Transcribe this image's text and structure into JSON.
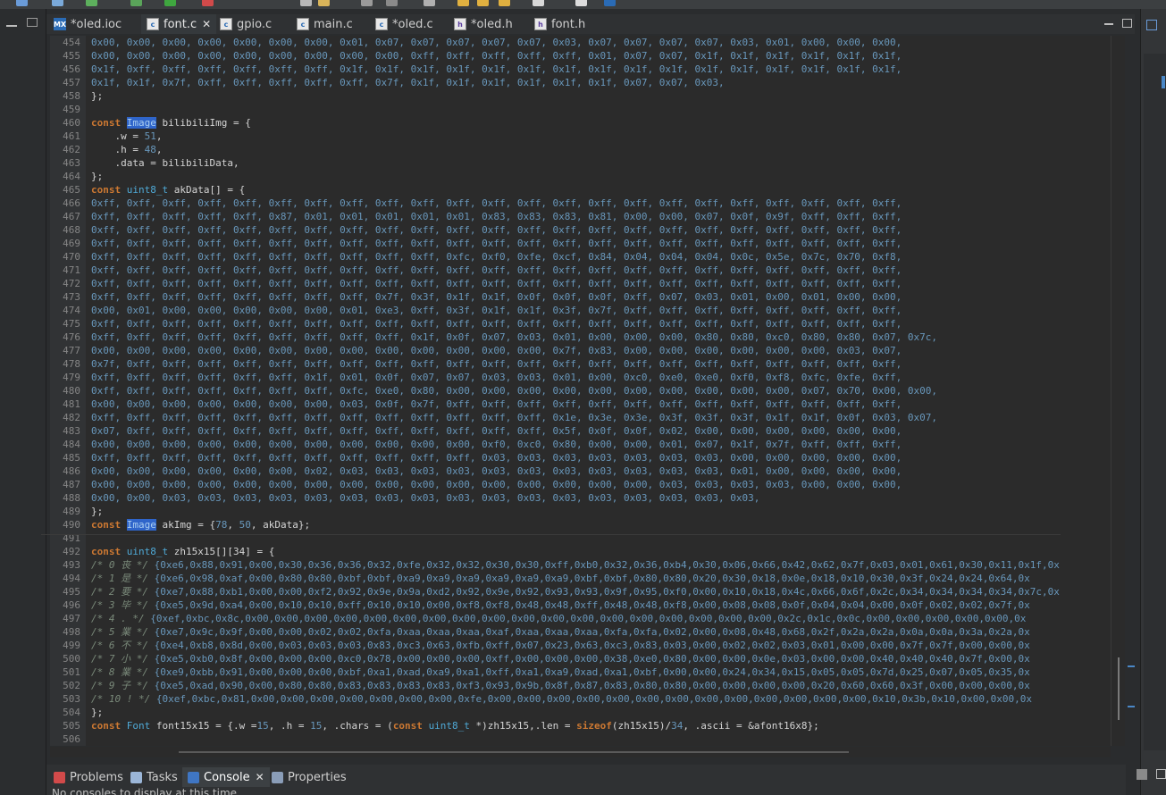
{
  "tabs": [
    {
      "label": "*oled.ioc",
      "icon": "mx-icon"
    },
    {
      "label": "font.c",
      "icon": "c-file-icon",
      "active": true,
      "close": "✕"
    },
    {
      "label": "gpio.c",
      "icon": "c-file-icon"
    },
    {
      "label": "main.c",
      "icon": "c-file-icon"
    },
    {
      "label": "*oled.c",
      "icon": "c-file-icon"
    },
    {
      "label": "*oled.h",
      "icon": "h-file-icon"
    },
    {
      "label": "font.h",
      "icon": "h-file-icon"
    }
  ],
  "tab_icon_text": {
    "mx": "MX",
    "c": "c",
    "h": "h"
  },
  "line_numbers": [
    "454",
    "455",
    "456",
    "457",
    "458",
    "459",
    "460",
    "461",
    "462",
    "463",
    "464",
    "465",
    "466",
    "467",
    "468",
    "469",
    "470",
    "471",
    "472",
    "473",
    "474",
    "475",
    "476",
    "477",
    "478",
    "479",
    "480",
    "481",
    "482",
    "483",
    "484",
    "485",
    "486",
    "487",
    "488",
    "489",
    "490",
    "491",
    "492",
    "493",
    "494",
    "495",
    "496",
    "497",
    "498",
    "499",
    "500",
    "501",
    "502",
    "503",
    "504",
    "505",
    "506"
  ],
  "code": {
    "l454": "0x00, 0x00, 0x00, 0x00, 0x00, 0x00, 0x00, 0x01, 0x07, 0x07, 0x07, 0x07, 0x07, 0x03, 0x07, 0x07, 0x07, 0x07, 0x03, 0x01, 0x00, 0x00, 0x00,",
    "l455": "0x00, 0x00, 0x00, 0x00, 0x00, 0x00, 0x00, 0x00, 0x00, 0xff, 0xff, 0xff, 0xff, 0xff, 0x01, 0x07, 0x07, 0x1f, 0x1f, 0x1f, 0x1f, 0x1f, 0x1f,",
    "l456": "0x1f, 0xff, 0xff, 0xff, 0xff, 0xff, 0xff, 0x1f, 0x1f, 0x1f, 0x1f, 0x1f, 0x1f, 0x1f, 0x1f, 0x1f, 0x1f, 0x1f, 0x1f, 0x1f, 0x1f, 0x1f, 0x1f,",
    "l457": "0x1f, 0x1f, 0x7f, 0xff, 0xff, 0xff, 0xff, 0xff, 0x7f, 0x1f, 0x1f, 0x1f, 0x1f, 0x1f, 0x1f, 0x07, 0x07, 0x03,",
    "l458": "};",
    "l460_kw": "const",
    "l460_ty": "Image",
    "l460_rest": " bilibiliImg = {",
    "l461_a": "    .w = ",
    "l461_n": "51",
    "l461_b": ",",
    "l462_a": "    .h = ",
    "l462_n": "48",
    "l462_b": ",",
    "l463": "    .data = bilibiliData,",
    "l464": "};",
    "l465_kw": "const",
    "l465_ty": "uint8_t",
    "l465_rest": " akData[] = {",
    "l466": "0xff, 0xff, 0xff, 0xff, 0xff, 0xff, 0xff, 0xff, 0xff, 0xff, 0xff, 0xff, 0xff, 0xff, 0xff, 0xff, 0xff, 0xff, 0xff, 0xff, 0xff, 0xff, 0xff,",
    "l467": "0xff, 0xff, 0xff, 0xff, 0xff, 0x87, 0x01, 0x01, 0x01, 0x01, 0x01, 0x83, 0x83, 0x83, 0x81, 0x00, 0x00, 0x07, 0x0f, 0x9f, 0xff, 0xff, 0xff,",
    "l468": "0xff, 0xff, 0xff, 0xff, 0xff, 0xff, 0xff, 0xff, 0xff, 0xff, 0xff, 0xff, 0xff, 0xff, 0xff, 0xff, 0xff, 0xff, 0xff, 0xff, 0xff, 0xff, 0xff,",
    "l469": "0xff, 0xff, 0xff, 0xff, 0xff, 0xff, 0xff, 0xff, 0xff, 0xff, 0xff, 0xff, 0xff, 0xff, 0xff, 0xff, 0xff, 0xff, 0xff, 0xff, 0xff, 0xff, 0xff,",
    "l470": "0xff, 0xff, 0xff, 0xff, 0xff, 0xff, 0xff, 0xff, 0xff, 0xff, 0xfc, 0xf0, 0xfe, 0xcf, 0x84, 0x04, 0x04, 0x04, 0x0c, 0x5e, 0x7c, 0x70, 0xf8,",
    "l471": "0xff, 0xff, 0xff, 0xff, 0xff, 0xff, 0xff, 0xff, 0xff, 0xff, 0xff, 0xff, 0xff, 0xff, 0xff, 0xff, 0xff, 0xff, 0xff, 0xff, 0xff, 0xff, 0xff,",
    "l472": "0xff, 0xff, 0xff, 0xff, 0xff, 0xff, 0xff, 0xff, 0xff, 0xff, 0xff, 0xff, 0xff, 0xff, 0xff, 0xff, 0xff, 0xff, 0xff, 0xff, 0xff, 0xff, 0xff,",
    "l473": "0xff, 0xff, 0xff, 0xff, 0xff, 0xff, 0xff, 0xff, 0x7f, 0x3f, 0x1f, 0x1f, 0x0f, 0x0f, 0x0f, 0xff, 0x07, 0x03, 0x01, 0x00, 0x01, 0x00, 0x00,",
    "l474": "0x00, 0x01, 0x00, 0x00, 0x00, 0x00, 0x00, 0x01, 0xe3, 0xff, 0x3f, 0x1f, 0x1f, 0x3f, 0x7f, 0xff, 0xff, 0xff, 0xff, 0xff, 0xff, 0xff, 0xff,",
    "l475": "0xff, 0xff, 0xff, 0xff, 0xff, 0xff, 0xff, 0xff, 0xff, 0xff, 0xff, 0xff, 0xff, 0xff, 0xff, 0xff, 0xff, 0xff, 0xff, 0xff, 0xff, 0xff, 0xff,",
    "l476": "0xff, 0xff, 0xff, 0xff, 0xff, 0xff, 0xff, 0xff, 0xff, 0x1f, 0x0f, 0x07, 0x03, 0x01, 0x00, 0x00, 0x00, 0x80, 0x80, 0xc0, 0x80, 0x80, 0x07, 0x7c,",
    "l477": "0x00, 0x00, 0x00, 0x00, 0x00, 0x00, 0x00, 0x00, 0x00, 0x00, 0x00, 0x00, 0x00, 0x7f, 0x83, 0x00, 0x00, 0x00, 0x00, 0x00, 0x00, 0x03, 0x07,",
    "l478": "0x7f, 0xff, 0xff, 0xff, 0xff, 0xff, 0xff, 0xff, 0xff, 0xff, 0xff, 0xff, 0xff, 0xff, 0xff, 0xff, 0xff, 0xff, 0xff, 0xff, 0xff, 0xff, 0xff,",
    "l479": "0xff, 0xff, 0xff, 0xff, 0xff, 0xff, 0x1f, 0x01, 0x0f, 0x07, 0x07, 0x03, 0x03, 0x01, 0x00, 0xc0, 0xe0, 0xe0, 0xf0, 0xf8, 0xfc, 0xfe, 0xff,",
    "l480": "0xff, 0xff, 0xff, 0xff, 0xff, 0xff, 0xff, 0xfc, 0xe0, 0x80, 0x00, 0x00, 0x00, 0x00, 0x00, 0x00, 0x00, 0x00, 0x00, 0x00, 0x07, 0x70, 0x00, 0x00,",
    "l481": "0x00, 0x00, 0x00, 0x00, 0x00, 0x00, 0x00, 0x03, 0x0f, 0x7f, 0xff, 0xff, 0xff, 0xff, 0xff, 0xff, 0xff, 0xff, 0xff, 0xff, 0xff, 0xff, 0xff,",
    "l482": "0xff, 0xff, 0xff, 0xff, 0xff, 0xff, 0xff, 0xff, 0xff, 0xff, 0xff, 0xff, 0xff, 0x1e, 0x3e, 0x3e, 0x3f, 0x3f, 0x3f, 0x1f, 0x1f, 0x0f, 0x03, 0x07,",
    "l483": "0x07, 0xff, 0xff, 0xff, 0xff, 0xff, 0xff, 0xff, 0xff, 0xff, 0xff, 0xff, 0xff, 0x5f, 0x0f, 0x0f, 0x02, 0x00, 0x00, 0x00, 0x00, 0x00, 0x00,",
    "l484": "0x00, 0x00, 0x00, 0x00, 0x00, 0x00, 0x00, 0x00, 0x00, 0x00, 0x00, 0xf0, 0xc0, 0x80, 0x00, 0x00, 0x01, 0x07, 0x1f, 0x7f, 0xff, 0xff, 0xff,",
    "l485": "0xff, 0xff, 0xff, 0xff, 0xff, 0xff, 0xff, 0xff, 0xff, 0xff, 0xff, 0x03, 0x03, 0x03, 0x03, 0x03, 0x03, 0x03, 0x00, 0x00, 0x00, 0x00, 0x00,",
    "l486": "0x00, 0x00, 0x00, 0x00, 0x00, 0x00, 0x02, 0x03, 0x03, 0x03, 0x03, 0x03, 0x03, 0x03, 0x03, 0x03, 0x03, 0x03, 0x01, 0x00, 0x00, 0x00, 0x00,",
    "l487": "0x00, 0x00, 0x00, 0x00, 0x00, 0x00, 0x00, 0x00, 0x00, 0x00, 0x00, 0x00, 0x00, 0x00, 0x00, 0x00, 0x03, 0x03, 0x03, 0x03, 0x00, 0x00, 0x00,",
    "l488": "0x00, 0x00, 0x03, 0x03, 0x03, 0x03, 0x03, 0x03, 0x03, 0x03, 0x03, 0x03, 0x03, 0x03, 0x03, 0x03, 0x03, 0x03, 0x03,",
    "l489": "};",
    "l490_kw": "const",
    "l490_ty": "Image",
    "l490_a": " akImg = {",
    "l490_n1": "78",
    "l490_b": ", ",
    "l490_n2": "50",
    "l490_c": ", akData};",
    "l492_kw": "const",
    "l492_ty": "uint8_t",
    "l492_rest": " zh15x15[][34] = {",
    "l493_cm": "/* 0 丧 */",
    "l493": " {0xe6,0x88,0x91,0x00,0x30,0x36,0x36,0x32,0xfe,0x32,0x32,0x30,0x30,0xff,0xb0,0x32,0x36,0xb4,0x30,0x06,0x66,0x42,0x62,0x7f,0x03,0x01,0x61,0x30,0x11,0x1f,0x",
    "l494_cm": "/* 1 是 */",
    "l494": " {0xe6,0x98,0xaf,0x00,0x80,0x80,0xbf,0xbf,0xa9,0xa9,0xa9,0xa9,0xa9,0xa9,0xbf,0xbf,0x80,0x80,0x20,0x30,0x18,0x0e,0x18,0x10,0x30,0x3f,0x24,0x24,0x64,0x",
    "l495_cm": "/* 2 要 */",
    "l495": " {0xe7,0x88,0xb1,0x00,0x00,0xf2,0x92,0x9e,0x9a,0xd2,0x92,0x9e,0x92,0x93,0x93,0x9f,0x95,0xf0,0x00,0x10,0x18,0x4c,0x66,0x6f,0x2c,0x34,0x34,0x34,0x34,0x7c,0x",
    "l496_cm": "/* 3 毕 */",
    "l496": " {0xe5,0x9d,0xa4,0x00,0x10,0x10,0xff,0x10,0x10,0x00,0xf8,0xf8,0x48,0x48,0xff,0x48,0x48,0xf8,0x00,0x08,0x08,0x0f,0x04,0x04,0x00,0x0f,0x02,0x02,0x7f,0x",
    "l497_cm": "/* 4 . */",
    "l497": " {0xef,0xbc,0x8c,0x00,0x00,0x00,0x00,0x00,0x00,0x00,0x00,0x00,0x00,0x00,0x00,0x00,0x00,0x00,0x00,0x00,0x00,0x2c,0x1c,0x0c,0x00,0x00,0x00,0x00,0x00,0x",
    "l498_cm": "/* 5 業 */",
    "l498": " {0xe7,0x9c,0x9f,0x00,0x00,0x02,0x02,0xfa,0xaa,0xaa,0xaa,0xaf,0xaa,0xaa,0xaa,0xfa,0xfa,0x02,0x00,0x08,0x48,0x68,0x2f,0x2a,0x2a,0x0a,0x0a,0x3a,0x2a,0x",
    "l499_cm": "/* 6 不 */",
    "l499": " {0xe4,0xb8,0x8d,0x00,0x03,0x03,0x03,0x83,0xc3,0x63,0xfb,0xff,0x07,0x23,0x63,0xc3,0x83,0x03,0x00,0x02,0x02,0x03,0x01,0x00,0x00,0x7f,0x7f,0x00,0x00,0x",
    "l500_cm": "/* 7 小 */",
    "l500": " {0xe5,0xb0,0x8f,0x00,0x00,0x00,0xc0,0x78,0x00,0x00,0x00,0xff,0x00,0x00,0x00,0x38,0xe0,0x80,0x00,0x00,0x0e,0x03,0x00,0x00,0x40,0x40,0x40,0x7f,0x00,0x",
    "l501_cm": "/* 8 業 */",
    "l501": " {0xe9,0xbb,0x91,0x00,0x00,0x00,0xbf,0xa1,0xad,0xa9,0xa1,0xff,0xa1,0xa9,0xad,0xa1,0xbf,0x00,0x00,0x24,0x34,0x15,0x05,0x05,0x7d,0x25,0x07,0x05,0x35,0x",
    "l502_cm": "/* 9 子 */",
    "l502": " {0xe5,0xad,0x90,0x00,0x80,0x80,0x83,0x83,0x83,0x83,0xf3,0x93,0x9b,0x8f,0x87,0x83,0x80,0x80,0x00,0x00,0x00,0x00,0x20,0x60,0x60,0x3f,0x00,0x00,0x00,0x",
    "l503_cm": "/* 10 ! */",
    "l503": " {0xef,0xbc,0x81,0x00,0x00,0x00,0x00,0x00,0x00,0x00,0xfe,0x00,0x00,0x00,0x00,0x00,0x00,0x00,0x00,0x00,0x00,0x00,0x00,0x00,0x10,0x3b,0x10,0x00,0x00,0x",
    "l504": "};",
    "l505_kw": "const",
    "l505_ty": "Font",
    "l505_a": " font15x15 = {.w =",
    "l505_n1": "15",
    "l505_b": ", .h = ",
    "l505_n2": "15",
    "l505_c": ", .chars = (",
    "l505_kw2": "const",
    "l505_ty2": "uint8_t",
    "l505_d": " *)zh15x15,.len = ",
    "l505_kw3": "sizeof",
    "l505_e": "(zh15x15)/",
    "l505_n3": "34",
    "l505_f": ", .ascii = &afont16x8};"
  },
  "bottom_tabs": [
    {
      "label": "Problems",
      "icon": "problems-icon"
    },
    {
      "label": "Tasks",
      "icon": "tasks-icon"
    },
    {
      "label": "Console",
      "icon": "console-icon",
      "active": true,
      "close": "✕"
    },
    {
      "label": "Properties",
      "icon": "properties-icon"
    }
  ],
  "console_message": "No consoles to display at this time.",
  "colors": {
    "hex": "#6897bb",
    "keyword": "#cc7832",
    "type": "#4fa9d6",
    "text": "#d4d4d4",
    "selection": "#2f65ca"
  }
}
